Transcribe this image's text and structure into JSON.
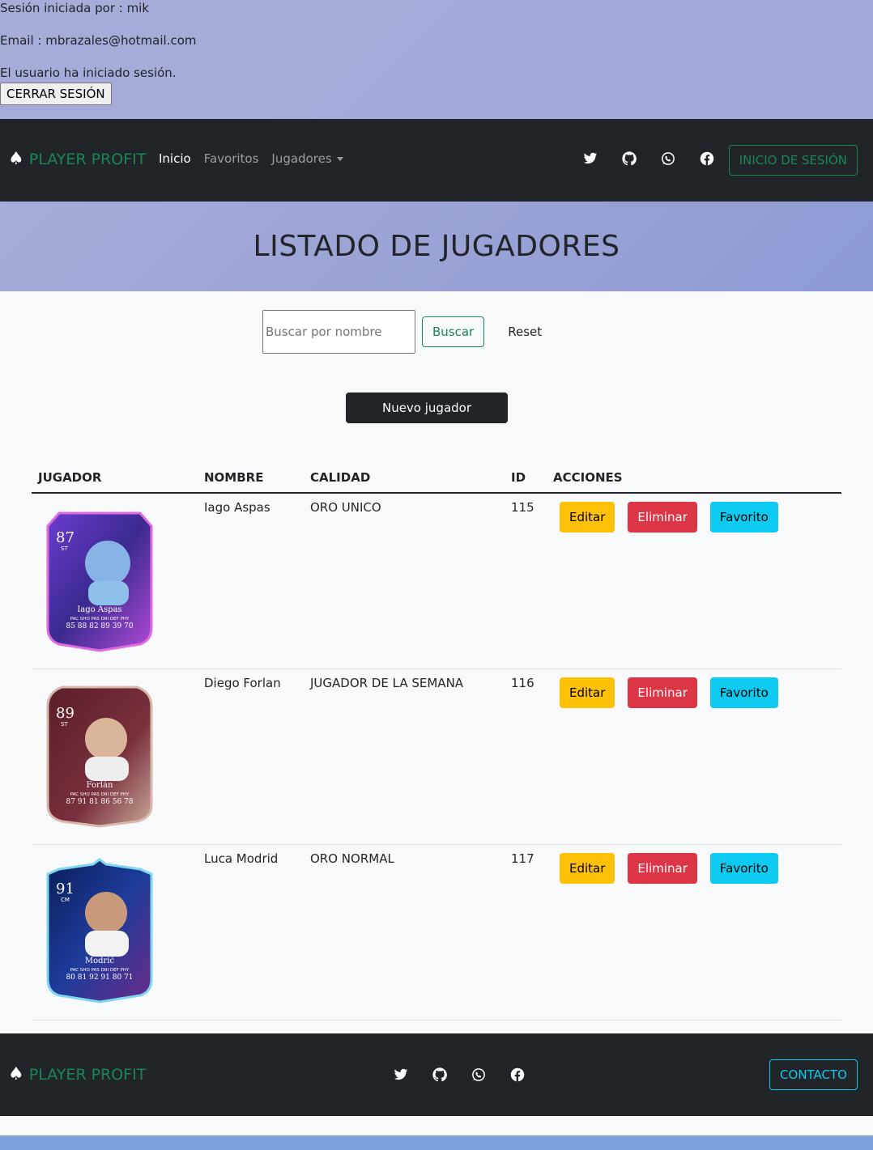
{
  "session": {
    "user_line": "Sesión iniciada por : mik",
    "email_line": "Email : mbrazales@hotmail.com",
    "status_line": "El usuario ha iniciado sesión.",
    "logout_label": "CERRAR SESIÓN"
  },
  "navbar": {
    "brand": "PLAYER PROFIT",
    "links": [
      {
        "label": "Inicio",
        "active": true
      },
      {
        "label": "Favoritos",
        "active": false
      },
      {
        "label": "Jugadores",
        "active": false
      }
    ],
    "social_icons": [
      "twitter-icon",
      "github-icon",
      "whatsapp-icon",
      "facebook-icon"
    ],
    "login_label": "INICIO DE SESIÓN"
  },
  "hero": {
    "title": "LISTADO DE JUGADORES"
  },
  "search": {
    "placeholder": "Buscar por nombre",
    "value": "",
    "button_label": "Buscar",
    "reset_label": "Reset"
  },
  "new_player_label": "Nuevo jugador",
  "table": {
    "headers": [
      "JUGADOR",
      "NOMBRE",
      "CALIDAD",
      "ID",
      "ACCIONES"
    ],
    "rows": [
      {
        "card": {
          "rating": "87",
          "position": "ST",
          "name": "Iago Aspas",
          "stat_labels": "PAC SHO PAS DRI DEF PHY",
          "stats": "85 88 82 89 39 70",
          "theme": "purple"
        },
        "nombre": "Iago Aspas",
        "calidad": "ORO UNICO",
        "id": "115"
      },
      {
        "card": {
          "rating": "89",
          "position": "ST",
          "name": "Forlán",
          "stat_labels": "PAC SHO PAS DRI DEF PHY",
          "stats": "87 91 81 86 56 78",
          "theme": "maroon"
        },
        "nombre": "Diego Forlan",
        "calidad": "JUGADOR DE LA SEMANA",
        "id": "116"
      },
      {
        "card": {
          "rating": "91",
          "position": "CM",
          "name": "Modrić",
          "stat_labels": "PAC SHO PAS DRI DEF PHY",
          "stats": "80 81 92 91 80 71",
          "theme": "navy"
        },
        "nombre": "Luca Modrid",
        "calidad": "ORO NORMAL",
        "id": "117"
      }
    ],
    "actions": {
      "edit": "Editar",
      "delete": "Eliminar",
      "favorite": "Favorito"
    }
  },
  "footer": {
    "brand": "PLAYER PROFIT",
    "contact_label": "CONTACTO"
  },
  "colors": {
    "dark": "#212529",
    "success": "#198754",
    "warning": "#ffc107",
    "danger": "#dc3545",
    "info": "#0dcaf0",
    "hero_bg": "#a7acd9"
  }
}
